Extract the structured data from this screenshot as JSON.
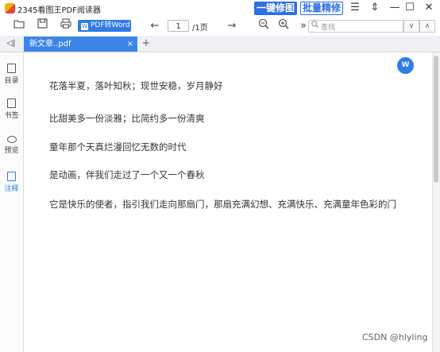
{
  "window": {
    "title": "2345看图王PDF阅读器",
    "promo_edit": "一键修图",
    "promo_fix": "批量精修",
    "controls": [
      "☰",
      "⇕",
      "—",
      "☐",
      "✕"
    ]
  },
  "toolbar": {
    "pdf_to_word": "PDF转Word",
    "page_current": "1",
    "page_total": "/1页",
    "search_placeholder": "查找",
    "more": "»"
  },
  "tabs": [
    {
      "label": "新文章..pdf",
      "close": "×",
      "active": true
    }
  ],
  "tab_add": "+",
  "panel_toggle": "◁|",
  "sidebar": {
    "items": [
      {
        "label": "目录",
        "icon": "toc-icon"
      },
      {
        "label": "书签",
        "icon": "bookmark-icon"
      },
      {
        "label": "预览",
        "icon": "preview-icon"
      },
      {
        "label": "注释",
        "icon": "annotation-icon",
        "active": true
      }
    ]
  },
  "document": {
    "lines": [
      "花落半夏，落叶知秋；现世安稳，岁月静好",
      "比甜美多一份淡雅；比简约多一份清爽",
      "童年那个天真烂漫回忆无数的时代",
      "是动画，伴我们走过了一个又一个春秋",
      "它是快乐的使者，指引我们走向那扇门，那扇充满幻想、充满快乐、充满童年色彩的门"
    ],
    "float_button": "W"
  },
  "watermark": "CSDN @hlyling",
  "colors": {
    "accent": "#2f7be8",
    "tab": "#3b86e8"
  }
}
